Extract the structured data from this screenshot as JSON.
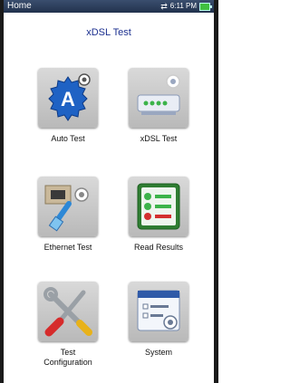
{
  "status_bar": {
    "title": "Home",
    "time": "6:11 PM"
  },
  "page": {
    "title": "xDSL Test"
  },
  "tiles": [
    {
      "label": "Auto Test",
      "icon": "auto-test-icon"
    },
    {
      "label": "xDSL Test",
      "icon": "xdsl-modem-icon"
    },
    {
      "label": "Ethernet Test",
      "icon": "ethernet-cable-icon"
    },
    {
      "label": "Read Results",
      "icon": "results-list-icon"
    },
    {
      "label": "Test Configuration",
      "icon": "tools-icon"
    },
    {
      "label": "System",
      "icon": "system-settings-icon"
    }
  ],
  "colors": {
    "title": "#1b2f8f",
    "status_bar": "#22324d",
    "battery": "#40c040"
  }
}
